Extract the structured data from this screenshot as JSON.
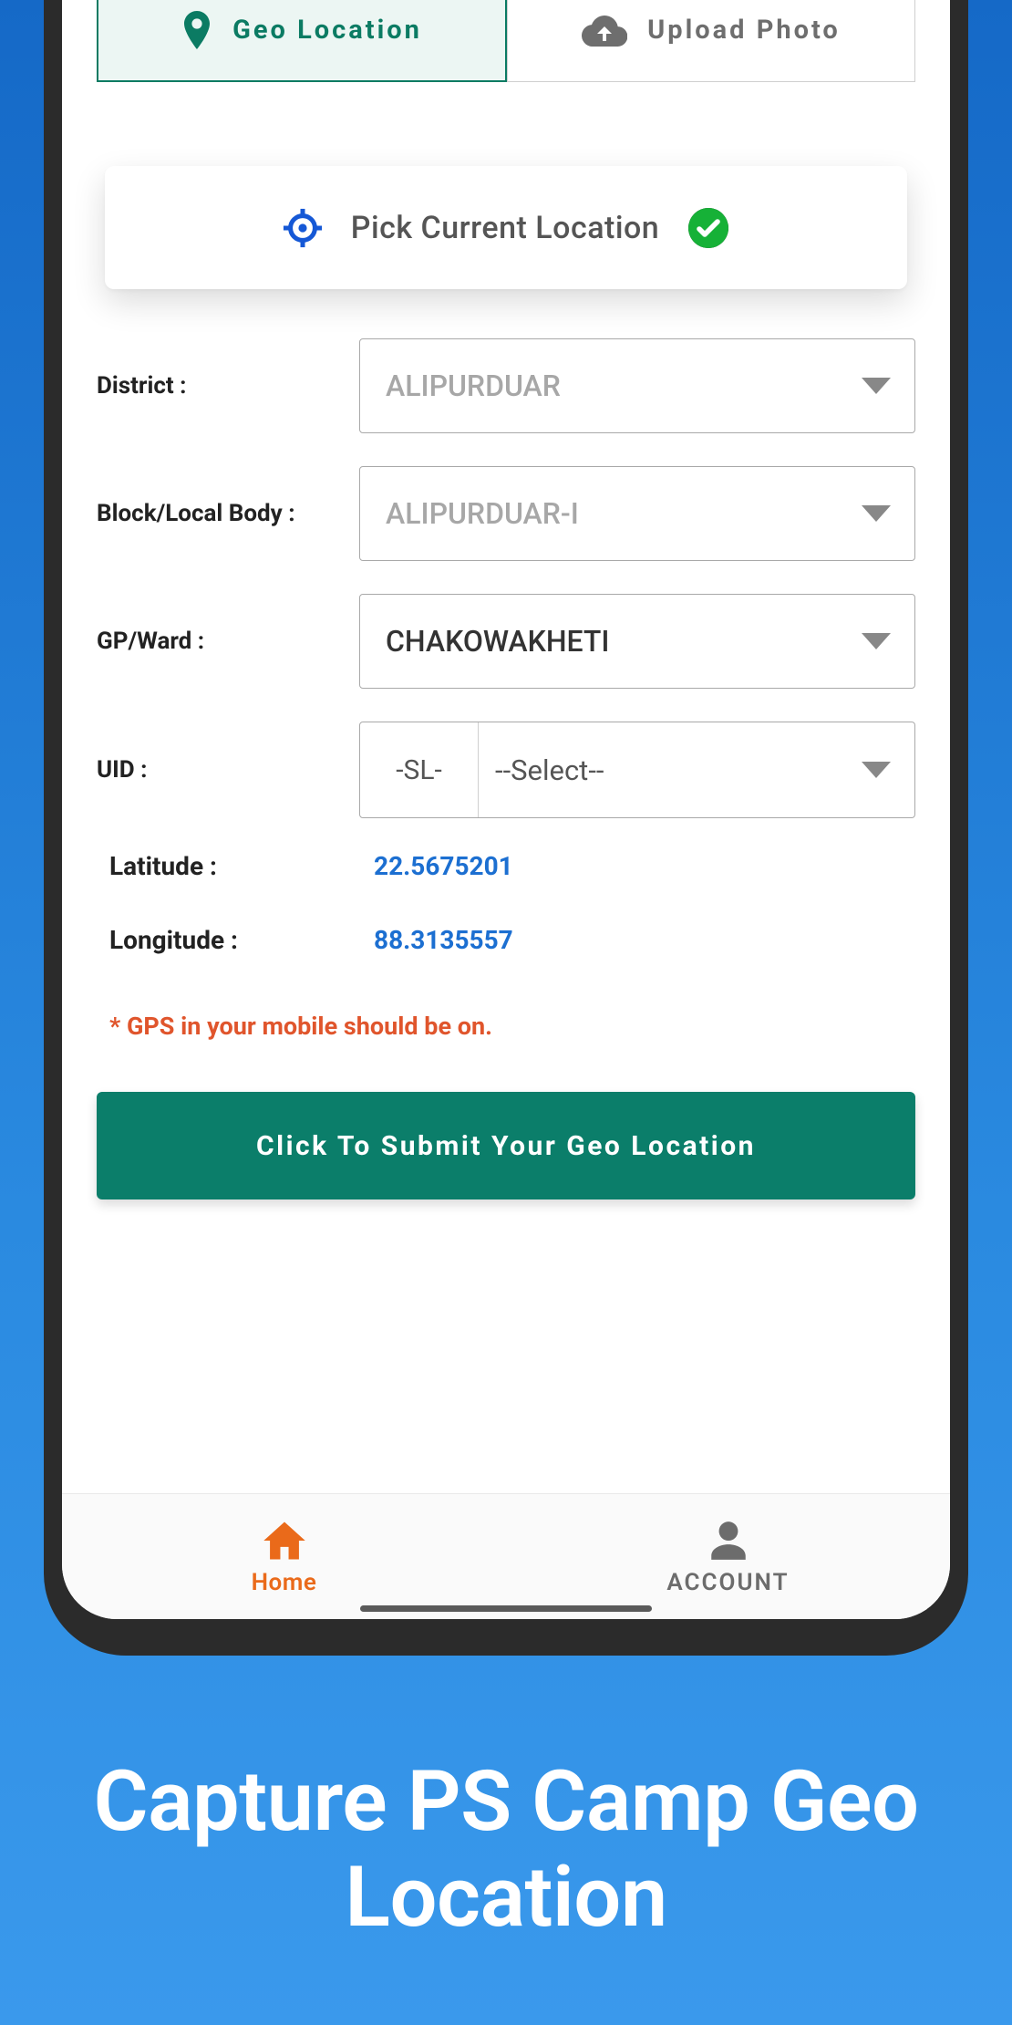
{
  "tabs": {
    "geo_label": "Geo Location",
    "upload_label": "Upload Photo"
  },
  "pick": {
    "label": "Pick Current Location"
  },
  "form": {
    "district_label": "District :",
    "district_value": "ALIPURDUAR",
    "block_label": "Block/Local Body :",
    "block_value": "ALIPURDUAR-I",
    "gpward_label": "GP/Ward :",
    "gpward_value": "CHAKOWAKHETI",
    "uid_label": "UID :",
    "uid_prefix": "-SL-",
    "uid_value": "--Select--"
  },
  "coords": {
    "lat_label": "Latitude :",
    "lat_value": "22.5675201",
    "lon_label": "Longitude :",
    "lon_value": "88.3135557"
  },
  "note_text": "* GPS in your mobile should be on.",
  "submit_label": "Click To Submit Your Geo Location",
  "nav": {
    "home_label": "Home",
    "account_label": "ACCOUNT"
  },
  "caption_text": "Capture PS Camp Geo Location",
  "colors": {
    "accent_teal": "#0b7e6a",
    "accent_orange": "#ea6a1a",
    "link_blue": "#1c6fd1",
    "warn": "#e0552c"
  }
}
